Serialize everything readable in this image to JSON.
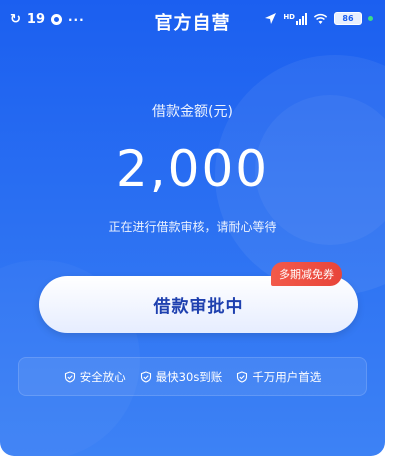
{
  "status_bar": {
    "time": "19",
    "more": "···",
    "title": "官方自营",
    "network": "HD",
    "battery": "86"
  },
  "loan": {
    "amount_label": "借款金额(元)",
    "amount": "2,000",
    "review_note": "正在进行借款审核，请耐心等待"
  },
  "status_button": {
    "label": "借款审批中"
  },
  "promo_badge": {
    "label": "多期减免券"
  },
  "features": [
    {
      "icon": "shield-check-icon",
      "label": "安全放心"
    },
    {
      "icon": "shield-check-icon",
      "label": "最快30s到账"
    },
    {
      "icon": "shield-check-icon",
      "label": "千万用户首选"
    }
  ],
  "colors": {
    "primary": "#1b5ff0",
    "button_text": "#1e40af",
    "badge": "#e8453a"
  }
}
